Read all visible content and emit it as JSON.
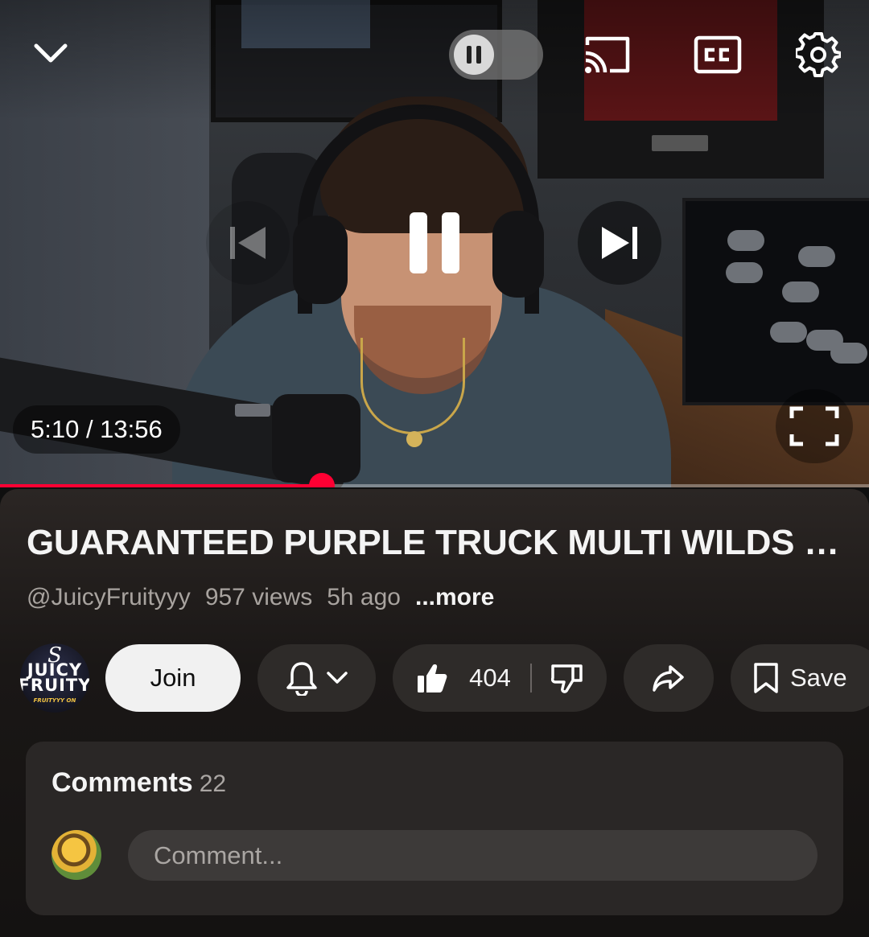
{
  "player": {
    "time": "5:10 / 13:56",
    "progress_fraction": 0.37,
    "icons": {
      "collapse": "chevron-down-icon",
      "autoplay": "autoplay-toggle",
      "cast": "cast-icon",
      "captions": "cc-icon",
      "settings": "gear-icon",
      "previous": "skip-previous-icon",
      "pause": "pause-icon",
      "next": "skip-next-icon",
      "fullscreen": "fullscreen-icon"
    },
    "accent": "#ff0033"
  },
  "video": {
    "title": "GUARANTEED PURPLE TRUCK MULTI WILDS o...",
    "channel": "@JuicyFruityyy",
    "views": "957 views",
    "age": "5h ago",
    "more": "...more"
  },
  "channel_avatar": {
    "initial": "S",
    "line1": "JUICY",
    "line2": "FRUITY",
    "tagline": "FRUITYYY ON"
  },
  "actions": {
    "join": "Join",
    "likes": "404",
    "save": "Save"
  },
  "comments": {
    "heading": "Comments",
    "count": "22",
    "placeholder": "Comment..."
  }
}
